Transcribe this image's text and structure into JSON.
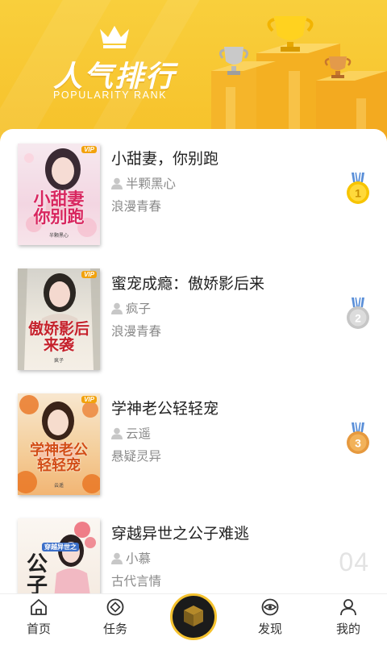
{
  "header": {
    "title": "人气排行",
    "subtitle": "POPULARITY RANK",
    "colors": {
      "background": "#F7C52E",
      "gold": "#F5B400",
      "silver": "#BFBFBF",
      "bronze": "#D98A3A"
    }
  },
  "books": [
    {
      "title": "小甜妻，你别跑",
      "author": "半颗黑心",
      "genre": "浪漫青春",
      "rank_badge": "1",
      "cover": {
        "text": "小甜妻\n你别跑",
        "author": "半颗黑心",
        "tag": "VIP"
      },
      "badge_color": "#F5B400"
    },
    {
      "title": "蜜宠成瘾：傲娇影后来",
      "author": "疯子",
      "genre": "浪漫青春",
      "rank_badge": "2",
      "cover": {
        "text": "傲娇影后\n来袭",
        "author": "疯子",
        "tag": "VIP"
      },
      "badge_color": "#BFBFBF"
    },
    {
      "title": "学神老公轻轻宠",
      "author": "云遥",
      "genre": "悬疑灵异",
      "rank_badge": "3",
      "cover": {
        "text": "学神老公\n轻轻宠",
        "author": "云遥",
        "tag": "VIP"
      },
      "badge_color": "#E39A3E"
    },
    {
      "title": "穿越异世之公子难逃",
      "author": "小慕",
      "genre": "古代言情",
      "rank_badge": "04",
      "cover": {
        "text": "公子\n难逃",
        "author": "小慕",
        "tag": "穿越异世之"
      }
    }
  ],
  "nav": {
    "items": [
      {
        "label": "首页",
        "icon": "home-icon"
      },
      {
        "label": "任务",
        "icon": "task-icon"
      },
      {
        "label": "",
        "icon": "cube-icon"
      },
      {
        "label": "发现",
        "icon": "discover-icon"
      },
      {
        "label": "我的",
        "icon": "user-icon"
      }
    ]
  }
}
